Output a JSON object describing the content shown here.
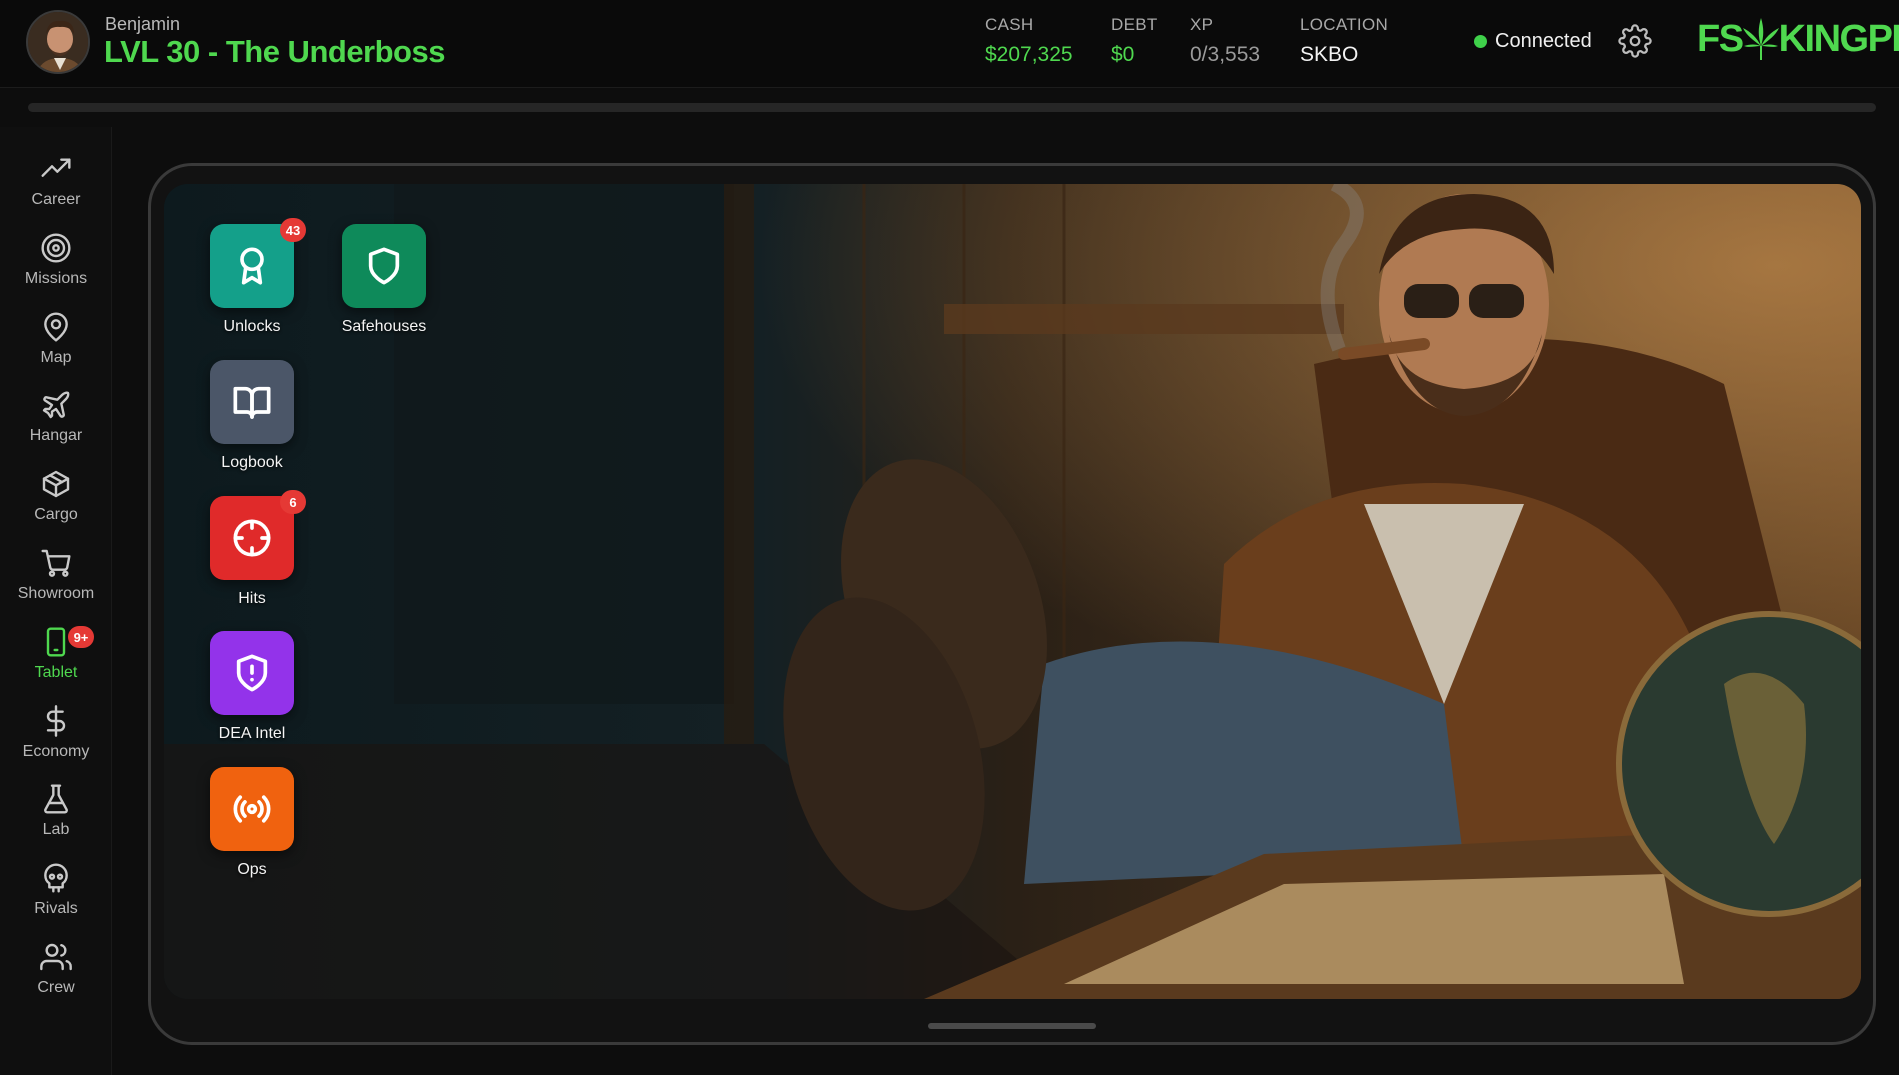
{
  "header": {
    "player_name": "Benjamin",
    "player_level": "LVL 30 - The Underboss",
    "stats": {
      "cash_label": "CASH",
      "cash_value": "$207,325",
      "debt_label": "DEBT",
      "debt_value": "$0",
      "xp_label": "XP",
      "xp_value": "0/3,553",
      "location_label": "LOCATION",
      "location_value": "SKBO"
    },
    "connection_status": "Connected",
    "logo_left": "FS",
    "logo_right": "KINGPIN",
    "xp_progress_percent": 0
  },
  "sidebar": {
    "items": [
      {
        "label": "Career",
        "icon": "trending-up-icon"
      },
      {
        "label": "Missions",
        "icon": "target-icon"
      },
      {
        "label": "Map",
        "icon": "map-pin-icon"
      },
      {
        "label": "Hangar",
        "icon": "plane-icon"
      },
      {
        "label": "Cargo",
        "icon": "package-icon"
      },
      {
        "label": "Showroom",
        "icon": "shopping-cart-icon"
      },
      {
        "label": "Tablet",
        "icon": "tablet-icon",
        "badge": "9+",
        "active": true
      },
      {
        "label": "Economy",
        "icon": "dollar-icon"
      },
      {
        "label": "Lab",
        "icon": "flask-icon"
      },
      {
        "label": "Rivals",
        "icon": "skull-icon"
      },
      {
        "label": "Crew",
        "icon": "users-icon"
      }
    ]
  },
  "tablet": {
    "apps": [
      {
        "label": "Unlocks",
        "badge": "43",
        "color": "#14a08a",
        "icon": "award-icon"
      },
      {
        "label": "Safehouses",
        "color": "#0e8a5a",
        "icon": "shield-icon"
      },
      {
        "label": "Logbook",
        "color": "#4b5668",
        "icon": "book-open-icon"
      },
      {
        "label": "Hits",
        "badge": "6",
        "color": "#e02a2a",
        "icon": "crosshair-icon"
      },
      {
        "label": "DEA Intel",
        "color": "#9333ea",
        "icon": "shield-alert-icon"
      },
      {
        "label": "Ops",
        "color": "#f0620f",
        "icon": "radio-icon"
      }
    ]
  },
  "colors": {
    "accent_green": "#4fd84f",
    "badge_red": "#e53935",
    "status_green": "#3fd14a"
  }
}
